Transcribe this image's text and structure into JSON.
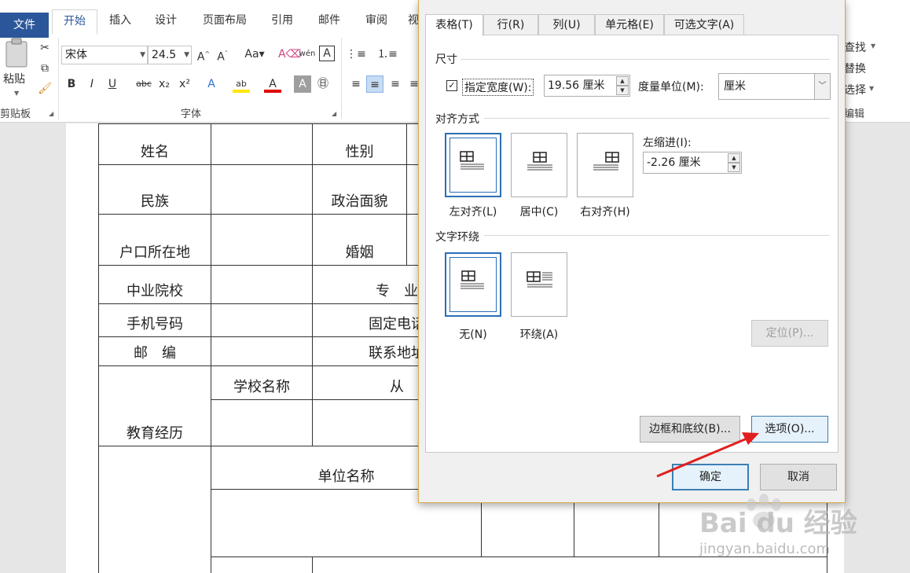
{
  "ribbon": {
    "tabs": [
      "文件",
      "开始",
      "插入",
      "设计",
      "页面布局",
      "引用",
      "邮件",
      "审阅",
      "视"
    ],
    "active_tab": "开始",
    "clipboard": {
      "paste_label": "粘贴",
      "group_label": "剪贴板"
    },
    "font": {
      "name": "宋体",
      "size": "24.5",
      "group_label": "字体"
    },
    "editing": {
      "find": "查找",
      "replace": "替换",
      "select": "选择",
      "group_label": "编辑"
    }
  },
  "form_table": {
    "rows": [
      [
        "姓名",
        "",
        "性别"
      ],
      [
        "民族",
        "",
        "政治面貌"
      ],
      [
        "户口所在地",
        "",
        "婚姻"
      ],
      [
        "中业院校",
        "",
        "专　业"
      ],
      [
        "手机号码",
        "",
        "固定电话"
      ],
      [
        "邮　编",
        "",
        "联系地址"
      ],
      [
        "教育经历",
        "学校名称",
        "从"
      ],
      [
        "单位名称"
      ]
    ]
  },
  "dialog": {
    "tabs": [
      "表格(T)",
      "行(R)",
      "列(U)",
      "单元格(E)",
      "可选文字(A)"
    ],
    "active_tab": "表格(T)",
    "size_section": "尺寸",
    "preferred_width_label": "指定宽度(W):",
    "preferred_width_checked": true,
    "preferred_width_value": "19.56 厘米",
    "measure_in_label": "度量单位(M):",
    "measure_in_value": "厘米",
    "alignment_section": "对齐方式",
    "alignment_options": [
      "左对齐(L)",
      "居中(C)",
      "右对齐(H)"
    ],
    "alignment_selected": "左对齐(L)",
    "indent_label": "左缩进(I):",
    "indent_value": "-2.26 厘米",
    "wrapping_section": "文字环绕",
    "wrapping_options": [
      "无(N)",
      "环绕(A)"
    ],
    "wrapping_selected": "无(N)",
    "positioning_button": "定位(P)...",
    "borders_button": "边框和底纹(B)...",
    "options_button": "选项(O)...",
    "ok_button": "确定",
    "cancel_button": "取消"
  },
  "watermark": {
    "brand": "Bai du 经验",
    "url": "jingyan.baidu.com"
  },
  "colors": {
    "file_tab": "#2b579a",
    "dialog_border": "#d8a94a",
    "arrow": "#e02020",
    "selected": "#2b6fb6"
  }
}
